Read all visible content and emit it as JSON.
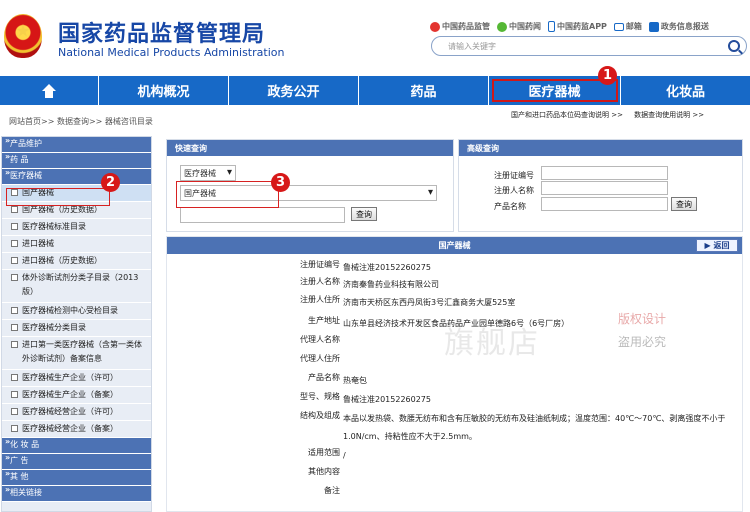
{
  "header": {
    "title_cn": "国家药品监督管理局",
    "title_en": "National Medical Products Administration",
    "links": [
      "中国药品监管",
      "中国药闻",
      "中国药监APP",
      "邮箱",
      "政务信息报送"
    ],
    "search_placeholder": "请输入关键字"
  },
  "nav": {
    "items": [
      "机构概况",
      "政务公开",
      "药品",
      "医疗器械",
      "化妆品"
    ]
  },
  "breadcrumb": "网站首页>> 数据查询>> 器械咨讯目录",
  "right_links": [
    "国产和进口药品本位码查询说明 >>",
    "数据查询使用说明 >>"
  ],
  "sidebar": {
    "cat_products": "产品维护",
    "cat_drugs": "药 品",
    "cat_devices": "医疗器械",
    "items": [
      "国产器械",
      "国产器械（历史数据）",
      "医疗器械标准目录",
      "进口器械",
      "进口器械（历史数据）",
      "体外诊断试剂分类子目录（2013版）",
      "医疗器械检测中心受检目录",
      "医疗器械分类目录",
      "进口第一类医疗器械（含第一类体外诊断试剂）备案信息",
      "医疗器械生产企业（许可）",
      "医疗器械生产企业（备案）",
      "医疗器械经营企业（许可）",
      "医疗器械经营企业（备案）"
    ],
    "cat_cosmetics": "化 妆 品",
    "cat_ads": "广 告",
    "cat_others": "其 他",
    "cat_related": "相关链接"
  },
  "quick_search": {
    "title": "快速查询",
    "select1": "医疗器械",
    "select2": "国产器械",
    "button": "查询"
  },
  "advanced_search": {
    "title": "高级查询",
    "labels": [
      "注册证编号",
      "注册人名称",
      "产品名称"
    ],
    "button": "查询"
  },
  "details": {
    "title": "国产器械",
    "back": "返回",
    "rows": [
      {
        "k": "注册证编号",
        "v": "鲁械注准20152260275"
      },
      {
        "k": "注册人名称",
        "v": "济南秦鲁药业科技有限公司"
      },
      {
        "k": "注册人住所",
        "v": "济南市天桥区东西丹凤街3号汇鑫商务大厦525室"
      },
      {
        "k": "生产地址",
        "v": "山东单县经济技术开发区食品药品产业园单德路6号（6号厂房）"
      },
      {
        "k": "代理人名称",
        "v": ""
      },
      {
        "k": "代理人住所",
        "v": ""
      },
      {
        "k": "产品名称",
        "v": "热奄包"
      },
      {
        "k": "型号、规格",
        "v": "鲁械注准20152260275"
      },
      {
        "k": "结构及组成",
        "v": "本品以发热袋、数腰无纺布和含有压敏胶的无纺布及硅油纸制成；温度范围：40℃～70℃、剥离强度不小于1.0N/cm、持粘性应不大于2.5mm。"
      },
      {
        "k": "适用范围",
        "v": "/"
      },
      {
        "k": "其他内容",
        "v": ""
      },
      {
        "k": "备注",
        "v": ""
      }
    ]
  },
  "annotations": [
    "1",
    "2",
    "3"
  ],
  "watermark": {
    "main": "旗舰店",
    "sub1": "版权设计",
    "sub2": "盗用必究"
  }
}
